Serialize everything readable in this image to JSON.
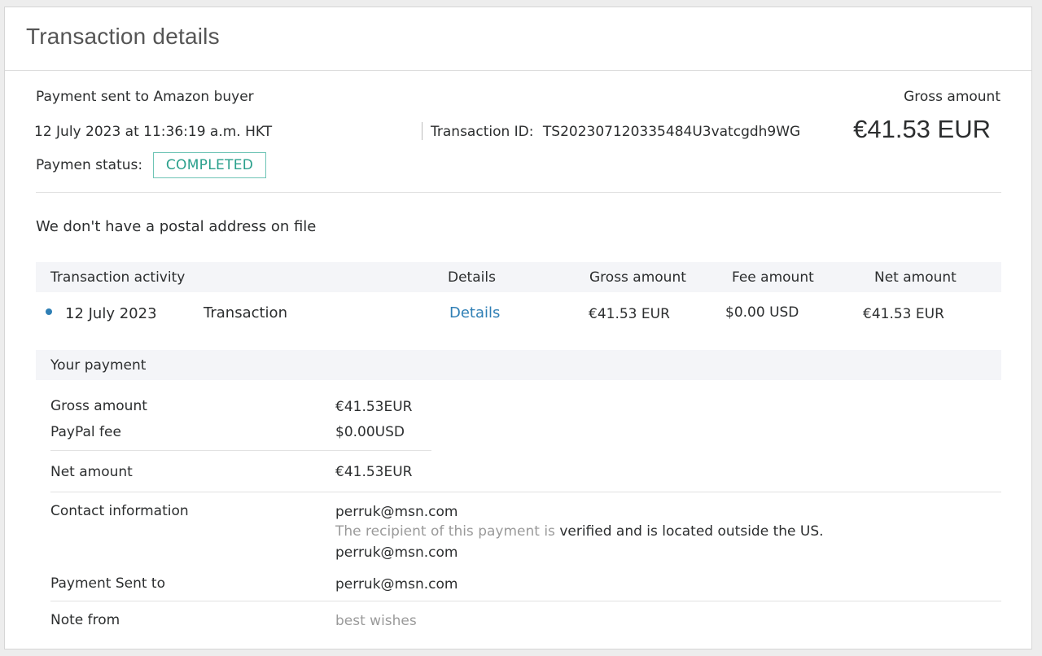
{
  "panel": {
    "title": "Transaction details"
  },
  "summary": {
    "description": "Payment sent to Amazon buyer",
    "datetime": "12 July 2023 at 11:36:19 a.m. HKT",
    "transaction_id_label": "Transaction ID:",
    "transaction_id": "TS202307120335484U3vatcgdh9WG",
    "status_label": "Paymen status:",
    "status_value": "COMPLETED",
    "gross_label": "Gross amount",
    "gross_value": "€41.53 EUR"
  },
  "address_note": "We don't have a postal address on file",
  "activity": {
    "headers": {
      "activity": "Transaction activity",
      "details": "Details",
      "gross": "Gross amount",
      "fee": "Fee amount",
      "net": "Net amount"
    },
    "rows": [
      {
        "date": "12 July 2023",
        "type": "Transaction",
        "details_link": "Details",
        "gross": "€41.53 EUR",
        "fee": "$0.00 USD",
        "net": "€41.53 EUR"
      }
    ]
  },
  "payment": {
    "header": "Your payment",
    "gross_label": "Gross amount",
    "gross_value": "€41.53EUR",
    "fee_label": "PayPal fee",
    "fee_value": "$0.00USD",
    "net_label": "Net amount",
    "net_value": "€41.53EUR",
    "contact_label": "Contact information",
    "contact_email": "perruk@msn.com",
    "verify_prefix": "The recipient of this payment is",
    "verify_status": "verified and is located outside the US.",
    "contact_email_2": "perruk@msn.com",
    "sent_to_label": "Payment Sent to",
    "sent_to_value": "perruk@msn.com",
    "note_label": "Note from",
    "note_value": "best wishes"
  },
  "colors": {
    "accent_link": "#2f7fb5",
    "status_green": "#2aa08c",
    "band_bg": "#f4f5f8"
  }
}
